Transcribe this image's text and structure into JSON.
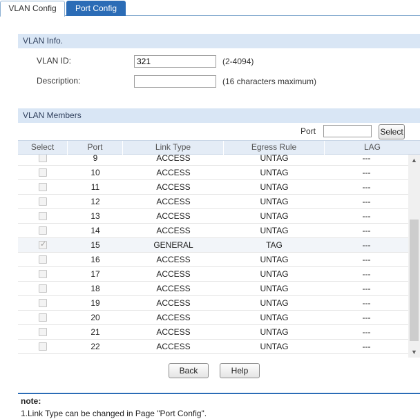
{
  "tabs": [
    {
      "label": "VLAN Config",
      "active": true
    },
    {
      "label": "Port Config",
      "active": false
    }
  ],
  "vlan_info": {
    "section_title": "VLAN Info.",
    "vlan_id_label": "VLAN ID:",
    "vlan_id_value": "321",
    "vlan_id_hint": "(2-4094)",
    "description_label": "Description:",
    "description_value": "",
    "description_hint": "(16 characters maximum)"
  },
  "vlan_members": {
    "section_title": "VLAN Members",
    "port_search_label": "Port",
    "port_search_value": "",
    "select_button": "Select",
    "columns": [
      "Select",
      "Port",
      "Link Type",
      "Egress Rule",
      "LAG"
    ],
    "rows": [
      {
        "port": "9",
        "link_type": "ACCESS",
        "egress": "UNTAG",
        "lag": "---",
        "checked": false
      },
      {
        "port": "10",
        "link_type": "ACCESS",
        "egress": "UNTAG",
        "lag": "---",
        "checked": false
      },
      {
        "port": "11",
        "link_type": "ACCESS",
        "egress": "UNTAG",
        "lag": "---",
        "checked": false
      },
      {
        "port": "12",
        "link_type": "ACCESS",
        "egress": "UNTAG",
        "lag": "---",
        "checked": false
      },
      {
        "port": "13",
        "link_type": "ACCESS",
        "egress": "UNTAG",
        "lag": "---",
        "checked": false
      },
      {
        "port": "14",
        "link_type": "ACCESS",
        "egress": "UNTAG",
        "lag": "---",
        "checked": false
      },
      {
        "port": "15",
        "link_type": "GENERAL",
        "egress": "TAG",
        "lag": "---",
        "checked": true
      },
      {
        "port": "16",
        "link_type": "ACCESS",
        "egress": "UNTAG",
        "lag": "---",
        "checked": false
      },
      {
        "port": "17",
        "link_type": "ACCESS",
        "egress": "UNTAG",
        "lag": "---",
        "checked": false
      },
      {
        "port": "18",
        "link_type": "ACCESS",
        "egress": "UNTAG",
        "lag": "---",
        "checked": false
      },
      {
        "port": "19",
        "link_type": "ACCESS",
        "egress": "UNTAG",
        "lag": "---",
        "checked": false
      },
      {
        "port": "20",
        "link_type": "ACCESS",
        "egress": "UNTAG",
        "lag": "---",
        "checked": false
      },
      {
        "port": "21",
        "link_type": "ACCESS",
        "egress": "UNTAG",
        "lag": "---",
        "checked": false
      },
      {
        "port": "22",
        "link_type": "ACCESS",
        "egress": "UNTAG",
        "lag": "---",
        "checked": false
      }
    ]
  },
  "buttons": {
    "back": "Back",
    "help": "Help"
  },
  "note": {
    "title": "note:",
    "line1": "1.Link Type can be changed in Page \"Port Config\"."
  },
  "colors": {
    "accent": "#2b6cb6",
    "section_bg": "#d9e6f5"
  }
}
